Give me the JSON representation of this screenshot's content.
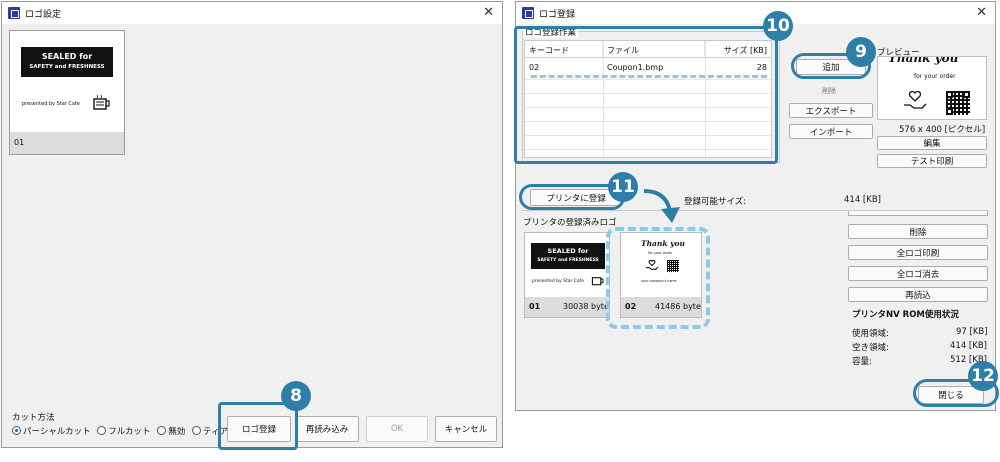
{
  "left_window": {
    "title": "ロゴ設定",
    "thumb": {
      "banner_line1": "SEALED for",
      "banner_line2": "SAFETY and FRESHNESS",
      "presented": "presented by Star Cafe",
      "id": "01"
    },
    "cut": {
      "label": "カット方法",
      "options": [
        "パーシャルカット",
        "フルカット",
        "無効",
        "ティアオフ"
      ],
      "selected": "パーシャルカット"
    },
    "buttons": {
      "logo_register": "ロゴ登録",
      "reload": "再読み込み",
      "ok": "OK",
      "cancel": "キャンセル"
    }
  },
  "right_window": {
    "title": "ロゴ登録",
    "group_title": "ロゴ登録作業",
    "table": {
      "headers": [
        "キーコード",
        "ファイル",
        "サイズ [KB]"
      ],
      "rows": [
        {
          "key": "02",
          "file": "Coupon1.bmp",
          "size": "28"
        }
      ]
    },
    "buttons": {
      "add": "追加",
      "delete_small": "削除",
      "export": "エクスポート",
      "import": "インポート",
      "edit": "編集",
      "test_print": "テスト印刷",
      "register_printer": "プリンタに登録",
      "delete": "削除",
      "print_all": "全ロゴ印刷",
      "erase_all": "全ロゴ消去",
      "reload": "再読込",
      "close": "閉じる"
    },
    "preview": {
      "label": "プレビュー",
      "heading": "Thank you",
      "subtext": "for your order",
      "size_text": "576 x 400 [ピクセル]"
    },
    "capacity_label": "登録可能サイズ:",
    "capacity_value": "414 [KB]",
    "registered_title": "プリンタの登録済みロゴ",
    "registered": [
      {
        "id": "01",
        "size": "30038 byte",
        "banner_line1": "SEALED for",
        "banner_line2": "SAFETY and FRESHNESS",
        "presented": "presented by Star Cafe"
      },
      {
        "id": "02",
        "size": "41486 byte",
        "heading": "Thank you",
        "subtext": "for your order",
        "footer": "your company's name"
      }
    ],
    "rom": {
      "title": "プリンタNV ROM使用状況",
      "used_label": "使用領域:",
      "used_value": "97 [KB]",
      "free_label": "空き領域:",
      "free_value": "414 [KB]",
      "capacity_label": "容量:",
      "capacity_value": "512 [KB]"
    }
  },
  "badges": {
    "b8": "8",
    "b9": "9",
    "b10": "10",
    "b11": "11",
    "b12": "12"
  },
  "colors": {
    "highlight": "#2e7fa8",
    "dashed": "#8ccbe8",
    "app_icon": "#2a3f9d"
  }
}
